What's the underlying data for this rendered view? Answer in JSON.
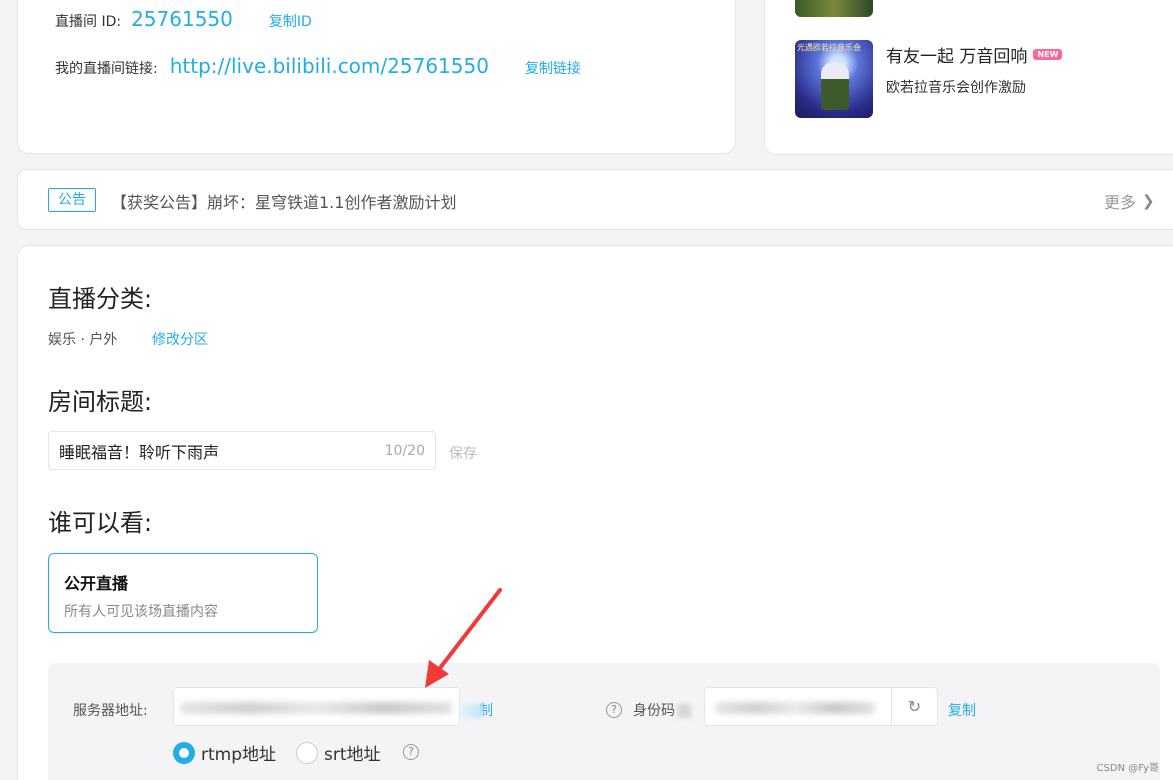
{
  "room": {
    "id_label": "直播间 ID:",
    "id_value": "25761550",
    "copy_id": "复制ID",
    "link_label": "我的直播间链接:",
    "link_value": "http://live.bilibili.com/25761550",
    "copy_link": "复制链接"
  },
  "activity": {
    "thumb_text": "光遇欧若拉音乐会",
    "title": "有友一起 万音回响",
    "badge": "NEW",
    "subtitle": "欧若拉音乐会创作激励"
  },
  "notice": {
    "tag": "公告",
    "text": "【获奖公告】崩坏：星穹铁道1.1创作者激励计划",
    "more": "更多"
  },
  "category": {
    "heading": "直播分类:",
    "value": "娱乐 · 户外",
    "edit": "修改分区"
  },
  "room_title": {
    "heading": "房间标题:",
    "value": "睡眠福音！聆听下雨声",
    "count": "10/20",
    "save": "保存"
  },
  "visibility": {
    "heading": "谁可以看:",
    "option_title": "公开直播",
    "option_desc": "所有人可见该场直播内容"
  },
  "stream": {
    "server_label": "服务器地址:",
    "copy_server": "制",
    "id_label": "身份码",
    "copy_id": "复制",
    "radio_rtmp": "rtmp地址",
    "radio_srt": "srt地址",
    "help": "?",
    "refresh_icon": "↻"
  },
  "watermark": "CSDN @Fy哥",
  "colors": {
    "accent": "#23ade5",
    "badge": "#ff6699",
    "arrow": "#f03a3a"
  }
}
